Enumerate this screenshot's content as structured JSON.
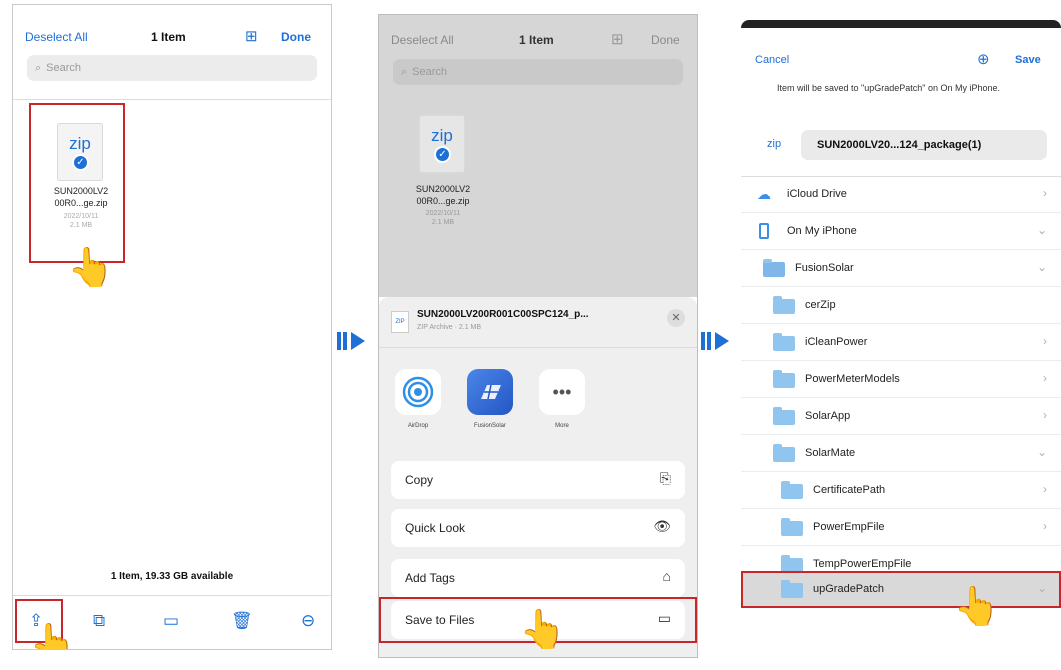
{
  "screen1": {
    "deselect_label": "Deselect All",
    "title": "1 Item",
    "done_label": "Done",
    "search_placeholder": "Search",
    "file": {
      "icon_text": "zip",
      "name_line1": "SUN2000LV2",
      "name_line2": "00R0...ge.zip",
      "date": "2022/10/11",
      "size": "2.1 MB"
    },
    "footer_status": "1 Item, 19.33 GB available"
  },
  "screen2": {
    "deselect_label": "Deselect All",
    "title": "1 Item",
    "done_label": "Done",
    "search_placeholder": "Search",
    "file": {
      "icon_text": "zip",
      "name_line1": "SUN2000LV2",
      "name_line2": "00R0...ge.zip",
      "date": "2022/10/11",
      "size": "2.1 MB"
    },
    "share_header": {
      "filename": "SUN2000LV200R001C00SPC124_p...",
      "subtitle": "ZIP Archive · 2.1 MB"
    },
    "apps": [
      {
        "label": "AirDrop",
        "icon": "airdrop-icon"
      },
      {
        "label": "FusionSolar",
        "icon": "fusionsolar-icon"
      },
      {
        "label": "More",
        "icon": "more-icon"
      }
    ],
    "actions": [
      {
        "label": "Copy",
        "icon": "copy-icon"
      },
      {
        "label": "Quick Look",
        "icon": "eye-icon"
      },
      {
        "label": "Add Tags",
        "icon": "tag-icon"
      },
      {
        "label": "Save to Files",
        "icon": "folder-icon"
      }
    ]
  },
  "screen3": {
    "cancel_label": "Cancel",
    "save_label": "Save",
    "info": "Item will be saved to \"upGradePatch\" on On My iPhone.",
    "zip_label": "zip",
    "zip_name": "SUN2000LV20...124_package(1)",
    "tree": [
      {
        "label": "iCloud Drive",
        "chevron": "›"
      },
      {
        "label": "On My iPhone",
        "chevron": "⌄"
      },
      {
        "label": "FusionSolar",
        "chevron": "⌄"
      },
      {
        "label": "cerZip",
        "chevron": ""
      },
      {
        "label": "iCleanPower",
        "chevron": "›"
      },
      {
        "label": "PowerMeterModels",
        "chevron": "›"
      },
      {
        "label": "SolarApp",
        "chevron": "›"
      },
      {
        "label": "SolarMate",
        "chevron": "⌄"
      },
      {
        "label": "CertificatePath",
        "chevron": "›"
      },
      {
        "label": "PowerEmpFile",
        "chevron": "›"
      },
      {
        "label": "TempPowerEmpFile",
        "chevron": ""
      },
      {
        "label": "upGradePatch",
        "chevron": "⌄"
      }
    ]
  },
  "colors": {
    "accent": "#1e6fd6",
    "highlight_red": "#c8262b",
    "folder_blue": "#8fc5ef"
  }
}
